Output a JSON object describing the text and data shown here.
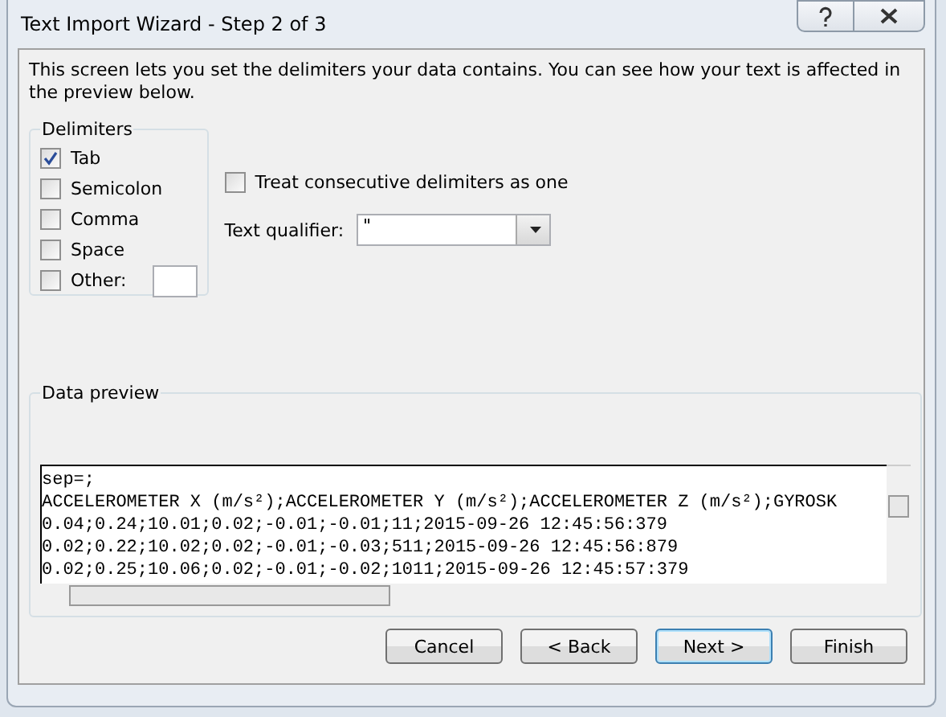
{
  "window": {
    "title": "Text Import Wizard - Step 2 of 3"
  },
  "intro": "This screen lets you set the delimiters your data contains.  You can see how your text is affected in the preview below.",
  "delimiters": {
    "title": "Delimiters",
    "items": [
      {
        "label": "Tab",
        "checked": true
      },
      {
        "label": "Semicolon",
        "checked": false
      },
      {
        "label": "Comma",
        "checked": false
      },
      {
        "label": "Space",
        "checked": false
      },
      {
        "label": "Other:",
        "checked": false
      }
    ]
  },
  "consecutive": {
    "label": "Treat consecutive delimiters as one",
    "checked": false
  },
  "text_qualifier": {
    "label": "Text qualifier:",
    "value": "\""
  },
  "preview": {
    "title": "Data preview",
    "lines": [
      "sep=;",
      "ACCELEROMETER X (m/s²);ACCELEROMETER Y (m/s²);ACCELEROMETER Z (m/s²);GYROSK",
      "0.04;0.24;10.01;0.02;-0.01;-0.01;11;2015-09-26 12:45:56:379",
      "0.02;0.22;10.02;0.02;-0.01;-0.03;511;2015-09-26 12:45:56:879",
      "0.02;0.25;10.06;0.02;-0.01;-0.02;1011;2015-09-26 12:45:57:379"
    ]
  },
  "buttons": [
    {
      "label": "Cancel",
      "default": false
    },
    {
      "label": "< Back",
      "default": false
    },
    {
      "label": "Next >",
      "default": true
    },
    {
      "label": "Finish",
      "default": false
    }
  ]
}
